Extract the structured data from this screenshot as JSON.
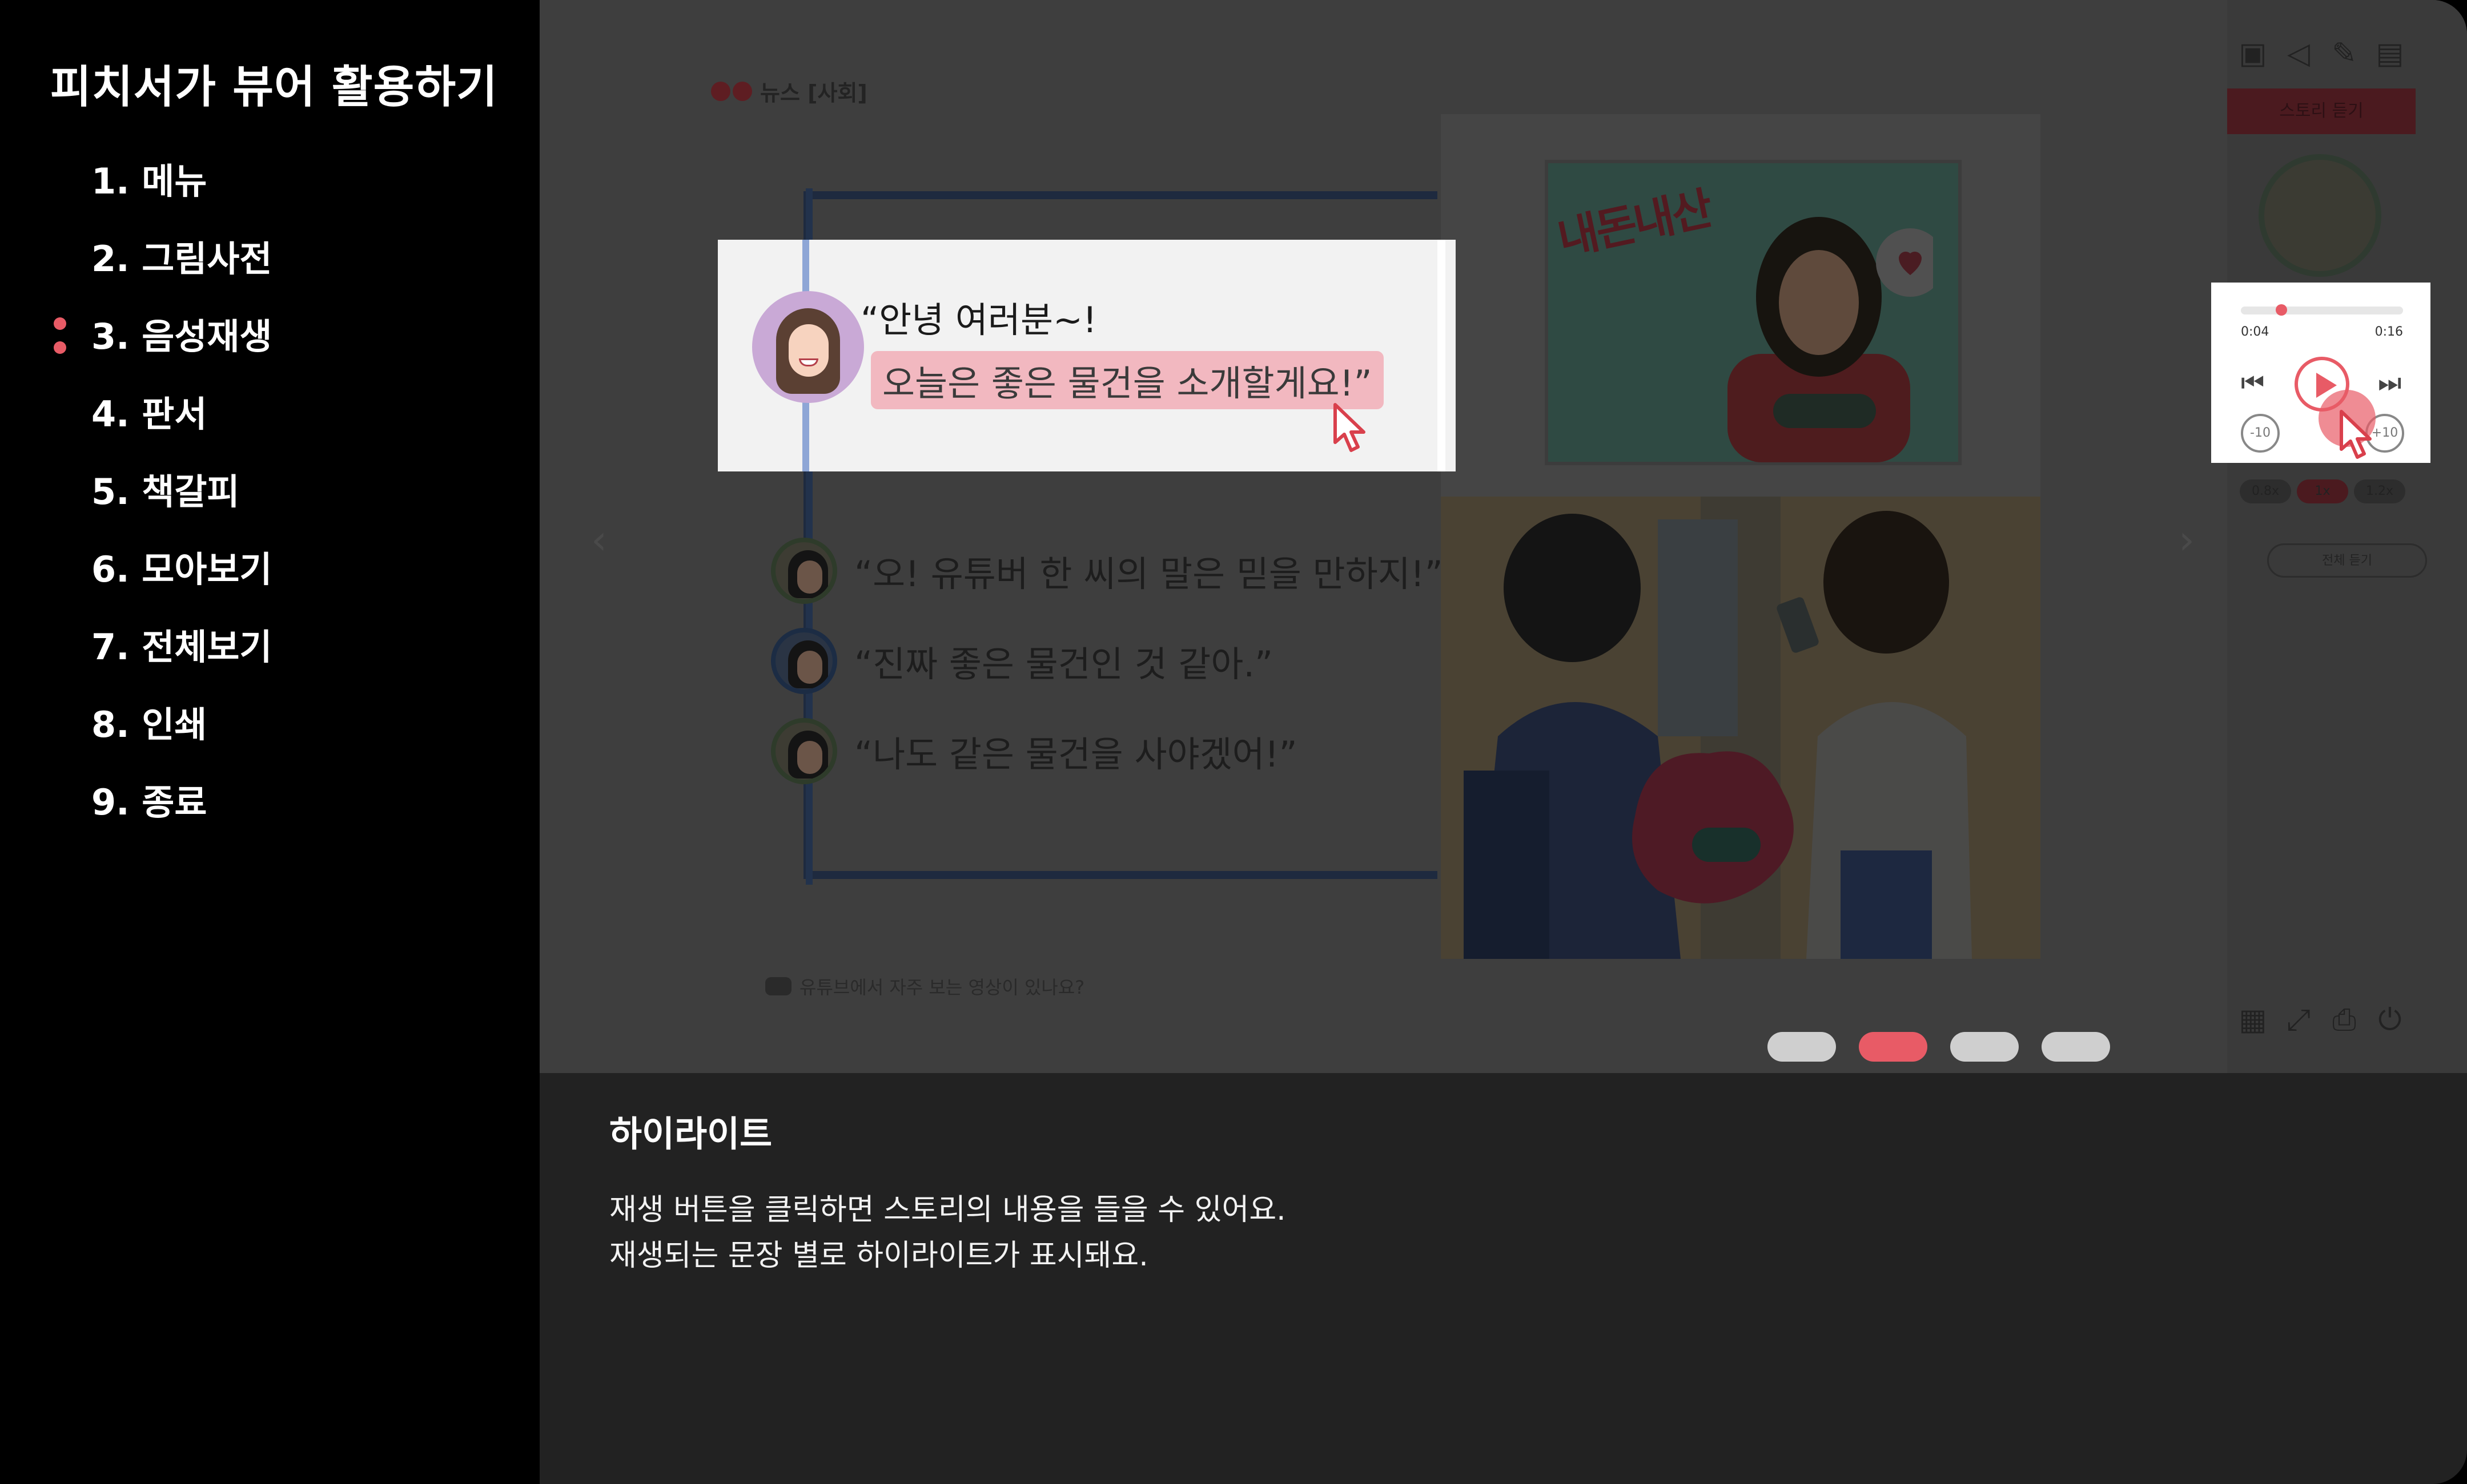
{
  "sidebar": {
    "title": "피치서가 뷰어 활용하기",
    "items": [
      {
        "label": "1. 메뉴"
      },
      {
        "label": "2. 그림사전"
      },
      {
        "label": "3. 음성재생",
        "active": true
      },
      {
        "label": "4. 판서"
      },
      {
        "label": "5. 책갈피"
      },
      {
        "label": "6. 모아보기"
      },
      {
        "label": "7. 전체보기"
      },
      {
        "label": "8. 인쇄"
      },
      {
        "label": "9. 종료"
      }
    ]
  },
  "viewer": {
    "category": "뉴스 [사회]",
    "illustration_logo": "내돈내산",
    "highlight": {
      "line1": "“안녕 여러분~!",
      "line2": "오늘은 좋은 물건을 소개할게요!”"
    },
    "dialogue": [
      {
        "text": "“오! 유튜버 한 씨의 말은 믿을 만하지!”"
      },
      {
        "text": "“진짜 좋은 물건인 것 같아.”"
      },
      {
        "text": "“나도 같은 물건을 사야겠어!”"
      }
    ],
    "question": "유튜브에서 자주 보는 영상이 있나요?",
    "story_button": "스토리 듣기",
    "player": {
      "current_time": "0:04",
      "total_time": "0:16",
      "progress": 0.25,
      "rewind_label": "-10",
      "forward_label": "+10"
    },
    "speeds": [
      "0.8x",
      "1x",
      "1.2x"
    ],
    "selected_speed": "1x",
    "repeat_label": "전체 듣기",
    "pages": 4,
    "current_page": 2
  },
  "caption": {
    "title": "하이라이트",
    "line1": "재생 버튼을 클릭하면 스토리의 내용을 들을 수 있어요.",
    "line2": "재생되는 문장 별로 하이라이트가 표시돼요."
  },
  "colors": {
    "accent": "#e85b66",
    "sidebar_bg": "#000000",
    "caption_bg": "#222222",
    "highlight_bg": "#f2b8c0"
  },
  "icons": [
    "dictionary-icon",
    "speaker-icon",
    "pen-icon",
    "bookmark-icon",
    "grid-icon",
    "fullscreen-icon",
    "print-icon",
    "power-icon"
  ]
}
